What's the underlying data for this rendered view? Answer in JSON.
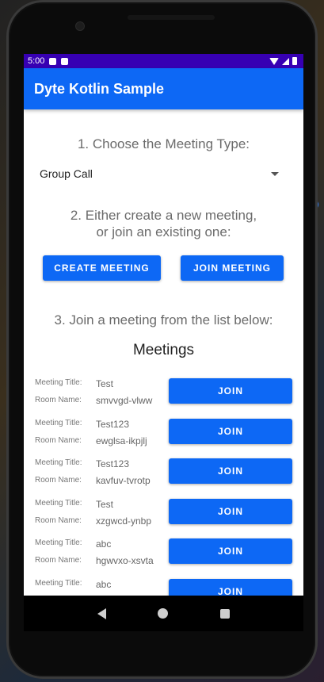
{
  "status_bar": {
    "time": "5:00"
  },
  "app_bar": {
    "title": "Dyte Kotlin Sample"
  },
  "step1": {
    "text": "1. Choose the Meeting Type:"
  },
  "meeting_type": {
    "selected": "Group Call"
  },
  "step2": {
    "line1": "2. Either create a new meeting,",
    "line2": "or join an existing one:"
  },
  "actions": {
    "create_label": "CREATE MEETING",
    "join_label": "JOIN MEETING"
  },
  "step3": {
    "text": "3. Join a meeting from the list below:"
  },
  "meetings": {
    "heading": "Meetings",
    "title_label": "Meeting Title:",
    "room_label": "Room Name:",
    "join_label": "JOIN",
    "items": [
      {
        "title": "Test",
        "room": "smvvgd-vlww"
      },
      {
        "title": "Test123",
        "room": "ewglsa-ikpjlj"
      },
      {
        "title": "Test123",
        "room": "kavfuv-tvrotp"
      },
      {
        "title": "Test",
        "room": "xzgwcd-ynbp"
      },
      {
        "title": "abc",
        "room": "hgwvxo-xsvta"
      },
      {
        "title": "abc",
        "room": ""
      }
    ]
  },
  "colors": {
    "primary": "#0d68f5",
    "status_bar": "#3700b3",
    "text_muted": "#6b6b6b"
  }
}
